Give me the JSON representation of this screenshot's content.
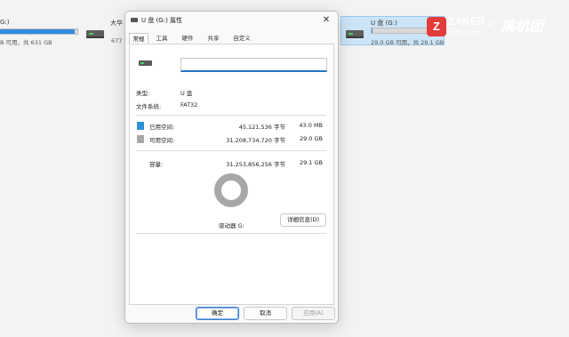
{
  "background": {
    "left_drive": {
      "label_partial": "G:)",
      "sub": "B 可用，共 631 GB",
      "used_fraction": 0.97
    },
    "middle_drive": {
      "label_partial": "大华",
      "sub_partial": "677"
    },
    "right_tile": {
      "label": "U 盘 (G:)",
      "sub": "29.0 GB 可用，共 29.1 GB",
      "used_fraction": 0.01
    }
  },
  "watermark": {
    "logo_letter": "Z",
    "brand": "ZAKER",
    "brand_sub": "直播科技新闻",
    "cross": "×",
    "partner": "搞机团"
  },
  "dialog": {
    "title": "U 盘 (G:) 属性",
    "close_glyph": "✕",
    "tabs": [
      "常规",
      "工具",
      "硬件",
      "共享",
      "自定义"
    ],
    "active_tab_index": 0,
    "name_value": "",
    "type_label": "类型:",
    "type_value": "U 盘",
    "fs_label": "文件系统:",
    "fs_value": "FAT32",
    "used": {
      "label": "已用空间:",
      "bytes": "45,121,536 字节",
      "size": "43.0 MB",
      "color": "#2c8fd6"
    },
    "free": {
      "label": "可用空间:",
      "bytes": "31,208,734,720 字节",
      "size": "29.0 GB",
      "color": "#a7a7a7"
    },
    "capacity": {
      "label": "容量:",
      "bytes": "31,253,856,256 字节",
      "size": "29.1 GB"
    },
    "drive_caption": "驱动器 G:",
    "details_button": "详细信息(D)",
    "buttons": {
      "ok": "确定",
      "cancel": "取消",
      "apply": "应用(A)"
    },
    "used_fraction": 0.0014
  }
}
